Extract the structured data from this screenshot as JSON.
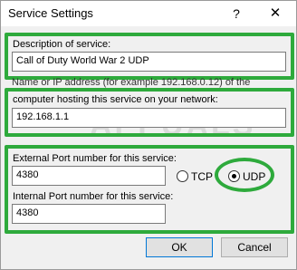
{
  "dialog": {
    "title": "Service Settings",
    "help_glyph": "?",
    "close_glyph": "✕"
  },
  "fields": {
    "description_label": "Description of service:",
    "description_value": "Call of Duty World War 2 UDP",
    "partial_hidden_text": "Name or IP address (for example 192.168.0.12) of the",
    "host_label": "computer hosting this service on your network:",
    "host_value": "192.168.1.1",
    "external_port_label": "External Port number for this service:",
    "external_port_value": "4380",
    "internal_port_label": "Internal Port number for this service:",
    "internal_port_value": "4380"
  },
  "protocol": {
    "tcp_label": "TCP",
    "udp_label": "UDP",
    "selected": "UDP"
  },
  "buttons": {
    "ok": "OK",
    "cancel": "Cancel"
  },
  "watermark": "APPUALS",
  "colors": {
    "highlight_green": "#2eaa3c",
    "default_button_border": "#0078d7"
  }
}
